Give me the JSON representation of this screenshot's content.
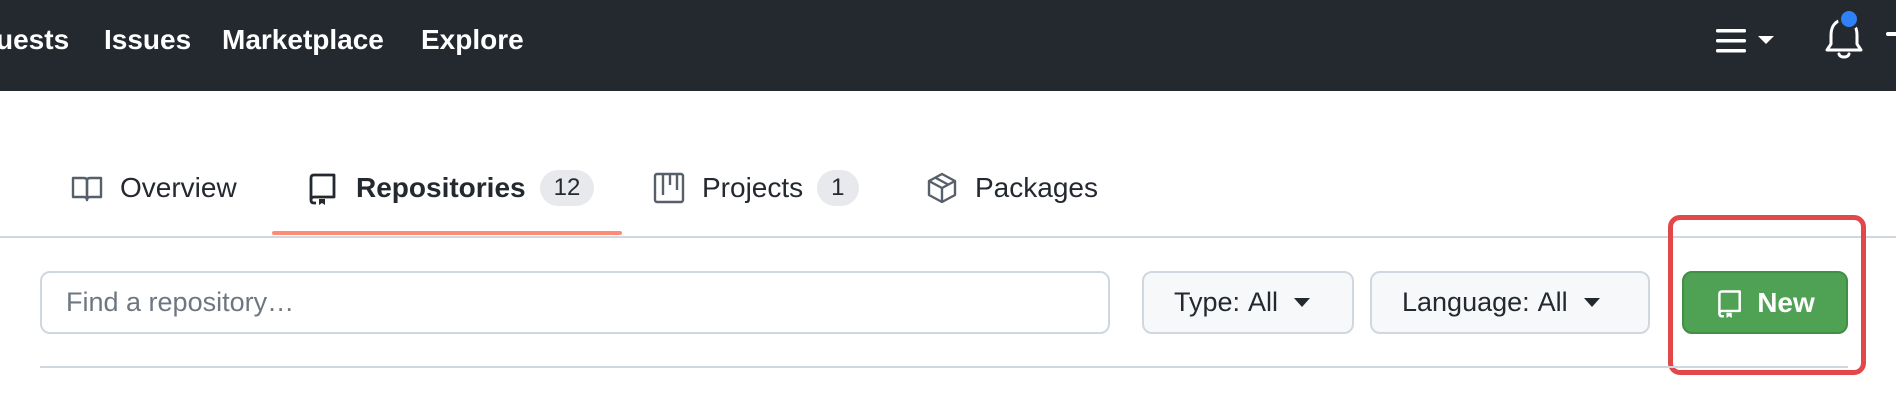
{
  "header": {
    "nav": [
      "uests",
      "Issues",
      "Marketplace",
      "Explore"
    ]
  },
  "tabs": [
    {
      "label": "Overview",
      "icon": "book-icon"
    },
    {
      "label": "Repositories",
      "icon": "repo-icon",
      "count": "12",
      "active": true
    },
    {
      "label": "Projects",
      "icon": "project-icon",
      "count": "1"
    },
    {
      "label": "Packages",
      "icon": "package-icon"
    }
  ],
  "search": {
    "placeholder": "Find a repository…",
    "value": ""
  },
  "filters": {
    "type": {
      "label": "Type:",
      "value": "All"
    },
    "language": {
      "label": "Language:",
      "value": "All"
    }
  },
  "new_button": {
    "label": "New",
    "icon": "repo-icon"
  },
  "colors": {
    "header_bg": "#24292f",
    "active_underline": "#fd8c73",
    "new_button_bg": "#4fa154",
    "highlight": "#e2474a",
    "notification_dot": "#2f81f7"
  }
}
